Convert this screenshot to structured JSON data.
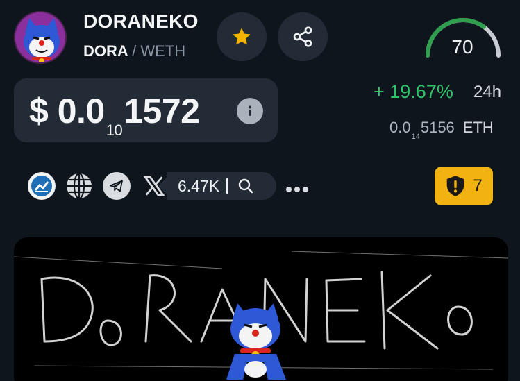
{
  "token": {
    "name": "DORANEKO",
    "symbol": "DORA",
    "separator": "/",
    "quote": "WETH"
  },
  "score": {
    "value": "70",
    "fraction": 0.7
  },
  "price": {
    "currency": "$",
    "prefix": "0.0",
    "zero_count": "10",
    "digits": "1572"
  },
  "change": {
    "percent": "+ 19.67%",
    "period": "24h"
  },
  "eth_price": {
    "prefix": "0.0",
    "zero_count": "14",
    "digits": "5156",
    "unit": "ETH"
  },
  "social": {
    "followers": "6.47K"
  },
  "audit": {
    "count": "7"
  },
  "icons": {
    "star": "star-icon",
    "share": "share-icon",
    "info": "info-icon",
    "dex": "chart-icon",
    "website": "globe-icon",
    "telegram": "telegram-icon",
    "x": "x-icon",
    "search": "search-icon",
    "more": "more-icon",
    "shield": "shield-alert-icon"
  },
  "colors": {
    "background": "#0f151c",
    "card": "#232b36",
    "positive": "#31c46b",
    "star": "#f4b400",
    "warning": "#f2b211",
    "gauge": "#2f9e4f"
  }
}
